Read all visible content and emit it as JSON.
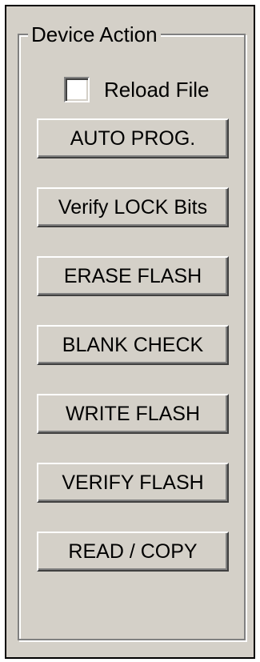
{
  "group": {
    "title": "Device Action"
  },
  "checkbox": {
    "label": "Reload File",
    "checked": false
  },
  "buttons": [
    "AUTO PROG.",
    "Verify LOCK Bits",
    "ERASE FLASH",
    "BLANK CHECK",
    "WRITE FLASH",
    "VERIFY FLASH",
    "READ / COPY"
  ],
  "colors": {
    "panel_bg": "#d4d0c8",
    "text": "#000000",
    "highlight": "#ffffff",
    "shadow": "#808080",
    "dark_shadow": "#404040"
  }
}
